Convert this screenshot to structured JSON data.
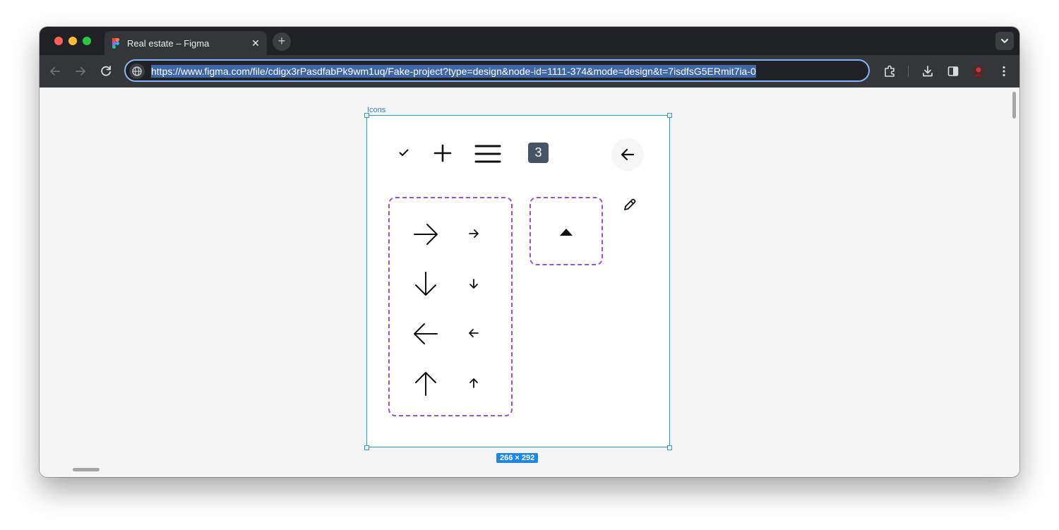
{
  "browser": {
    "tab": {
      "title": "Real estate – Figma",
      "close_symbol": "✕"
    },
    "new_tab_symbol": "+",
    "address_bar": {
      "url": "https://www.figma.com/file/cdigx3rPasdfabPk9wm1uq/Fake-project?type=design&node-id=1111-374&mode=design&t=7isdfsG5ERmit7ia-0"
    }
  },
  "canvas": {
    "frame": {
      "label": "Icons",
      "size_badge": "266 × 292",
      "badge_number": "3"
    },
    "icons": [
      "check-icon",
      "plus-icon",
      "hamburger-menu-icon",
      "number-badge",
      "arrow-left-circle-icon",
      "pencil-icon",
      "arrow-right-large-icon",
      "arrow-right-small-icon",
      "arrow-down-large-icon",
      "arrow-down-small-icon",
      "arrow-left-large-icon",
      "arrow-left-small-icon",
      "arrow-up-large-icon",
      "arrow-up-small-icon",
      "triangle-up-icon"
    ]
  },
  "colors": {
    "selection": "#2b96f0",
    "component_set_border": "#9b51e0",
    "badge_bg": "#475466",
    "chrome_dark": "#202124",
    "chrome_toolbar": "#35363a"
  }
}
